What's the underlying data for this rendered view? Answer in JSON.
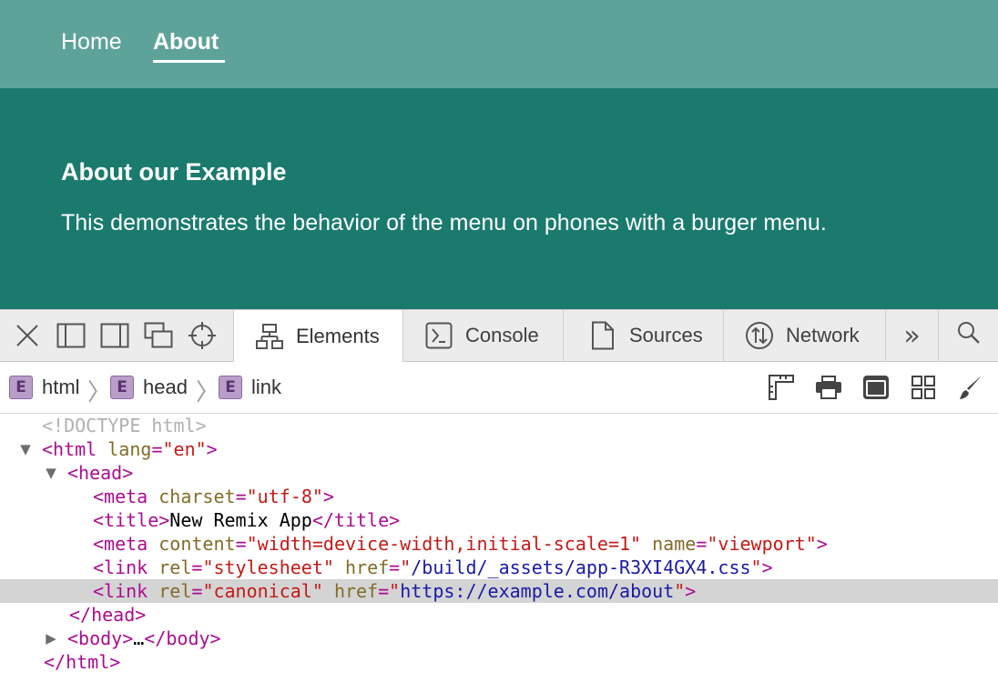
{
  "site": {
    "nav": {
      "home": "Home",
      "about": "About"
    },
    "hero": {
      "title": "About our Example",
      "text": "This demonstrates the behavior of the menu on phones with a burger menu."
    }
  },
  "devtools": {
    "toolbar_icons": [
      "close-icon",
      "dock-left-icon",
      "dock-right-icon",
      "detach-icon",
      "inspect-icon"
    ],
    "tabs": {
      "elements": "Elements",
      "console": "Console",
      "sources": "Sources",
      "network": "Network",
      "more": "»"
    },
    "active_tab": "Elements",
    "breadcrumb": {
      "badge": "E",
      "items": [
        "html",
        "head",
        "link"
      ]
    },
    "crumb_tools": [
      "ruler-icon",
      "print-icon",
      "window-icon",
      "grid-icon",
      "brush-icon"
    ],
    "dom": {
      "doctype": "<!DOCTYPE html>",
      "html_open": {
        "tag": "<html",
        "attr": "lang",
        "val": "\"en\"",
        "close": ">"
      },
      "head_open": "<head>",
      "meta1": {
        "tag": "<meta",
        "attr": "charset",
        "val": "\"utf-8\"",
        "close": ">"
      },
      "title": {
        "open": "<title>",
        "text": "New Remix App",
        "close": "</title>"
      },
      "meta2": {
        "tag": "<meta",
        "attr1": "content",
        "val1": "\"width=device-width,initial-scale=1\"",
        "attr2": "name",
        "val2": "\"viewport\"",
        "close": ">"
      },
      "link1": {
        "tag": "<link",
        "attr1": "rel",
        "val1": "\"stylesheet\"",
        "attr2": "href",
        "q_open": "\"",
        "href": "/build/_assets/app-R3XI4GX4.css",
        "q_close": "\"",
        "close": ">"
      },
      "link2": {
        "tag": "<link",
        "attr1": "rel",
        "val1": "\"canonical\"",
        "attr2": "href",
        "q_open": "\"",
        "href": "https://example.com/about",
        "q_close": "\"",
        "close": ">"
      },
      "head_close": "</head>",
      "body": {
        "open": "<body>",
        "ellipsis": "…",
        "close": "</body>"
      },
      "html_close": "</html>"
    }
  },
  "colors": {
    "nav_bg": "#5ea39a",
    "hero_bg": "#1a7a6e",
    "tag": "#aa0d91",
    "attr": "#836c28",
    "value": "#c41a16",
    "link": "#1a1aa6",
    "selected_row": "#d4d4d4"
  }
}
